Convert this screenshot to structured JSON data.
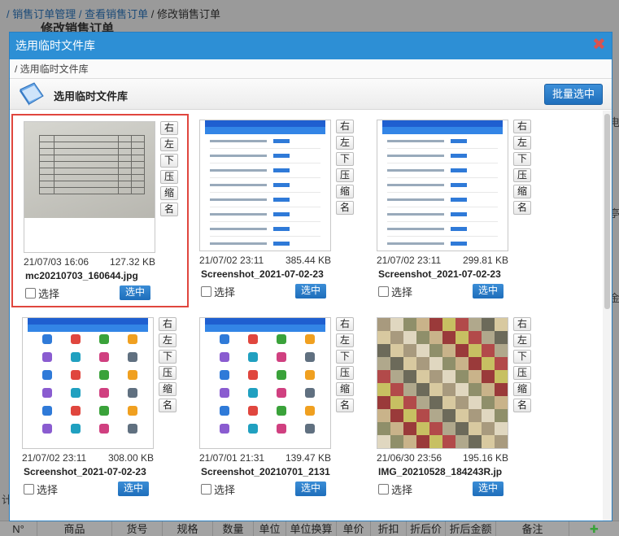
{
  "background": {
    "breadcrumb": [
      "/ 销售订单管理",
      "/ 查看销售订单",
      "/ 修改销售订单"
    ],
    "page_title": "修改销售订单",
    "side_chars": [
      "电",
      "亭",
      "金"
    ],
    "left_char": "计",
    "table_columns": [
      "N°",
      "商品",
      "货号",
      "规格",
      "数量",
      "单位",
      "单位换算",
      "单价",
      "折扣",
      "折后价",
      "折后金额",
      "备注",
      "✚"
    ]
  },
  "modal": {
    "title": "选用临时文件库",
    "close_icon": "close-icon",
    "crumb": "/ 选用临时文件库",
    "toolbar_title": "选用临时文件库",
    "batch_button": "批量选中",
    "side_buttons": [
      "右",
      "左",
      "下",
      "压",
      "缩",
      "名"
    ],
    "checkbox_label": "选择",
    "pick_button": "选中",
    "files": [
      {
        "date": "21/07/03 16:06",
        "size": "127.32 KB",
        "name": "mc20210703_160644.jpg",
        "selected": true,
        "kind": "document-photo"
      },
      {
        "date": "21/07/02 23:11",
        "size": "385.44 KB",
        "name": "Screenshot_2021-07-02-23",
        "selected": false,
        "kind": "phone-list"
      },
      {
        "date": "21/07/02 23:11",
        "size": "299.81 KB",
        "name": "Screenshot_2021-07-02-23",
        "selected": false,
        "kind": "phone-list"
      },
      {
        "date": "21/07/02 23:11",
        "size": "308.00 KB",
        "name": "Screenshot_2021-07-02-23",
        "selected": false,
        "kind": "phone-icons"
      },
      {
        "date": "21/07/01 21:31",
        "size": "139.47 KB",
        "name": "Screenshot_20210701_2131",
        "selected": false,
        "kind": "phone-icons"
      },
      {
        "date": "21/06/30 23:56",
        "size": "195.16 KB",
        "name": "IMG_20210528_184243R.jp",
        "selected": false,
        "kind": "pixelated-photo"
      }
    ]
  },
  "colors": {
    "header_blue": "#2d8fd5",
    "button_blue": "#1e6ebb",
    "selection_red": "#e0463e"
  }
}
